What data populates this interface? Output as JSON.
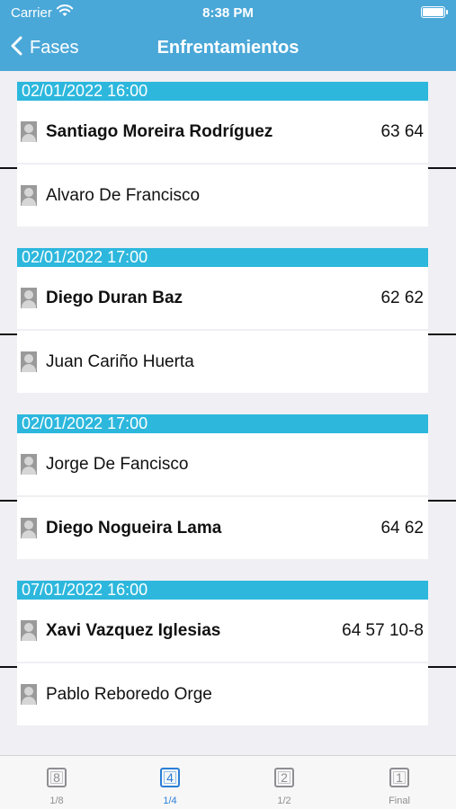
{
  "status_bar": {
    "carrier": "Carrier",
    "time": "8:38 PM"
  },
  "nav": {
    "back_label": "Fases",
    "title": "Enfrentamientos"
  },
  "matches": [
    {
      "date": "02/01/2022 16:00",
      "players": [
        {
          "name": "Santiago Moreira Rodríguez",
          "score": "63 64",
          "winner": true
        },
        {
          "name": "Alvaro De Francisco",
          "score": "",
          "winner": false
        }
      ]
    },
    {
      "date": "02/01/2022 17:00",
      "players": [
        {
          "name": "Diego Duran Baz",
          "score": "62 62",
          "winner": true
        },
        {
          "name": "Juan Cariño Huerta",
          "score": "",
          "winner": false
        }
      ]
    },
    {
      "date": "02/01/2022 17:00",
      "players": [
        {
          "name": "Jorge De Fancisco",
          "score": "",
          "winner": false
        },
        {
          "name": "Diego Nogueira Lama",
          "score": "64 62",
          "winner": true
        }
      ]
    },
    {
      "date": "07/01/2022 16:00",
      "players": [
        {
          "name": "Xavi Vazquez Iglesias",
          "score": "64 57 10-8",
          "winner": true
        },
        {
          "name": "Pablo Reboredo Orge",
          "score": "",
          "winner": false
        }
      ]
    }
  ],
  "tabs": [
    {
      "icon_text": "8",
      "label": "1/8",
      "active": false
    },
    {
      "icon_text": "4",
      "label": "1/4",
      "active": true
    },
    {
      "icon_text": "2",
      "label": "1/2",
      "active": false
    },
    {
      "icon_text": "1",
      "label": "Final",
      "active": false
    }
  ],
  "colors": {
    "nav": "#4aa8d8",
    "date_bar": "#2db7dd",
    "active_tab": "#2b7fd6"
  }
}
